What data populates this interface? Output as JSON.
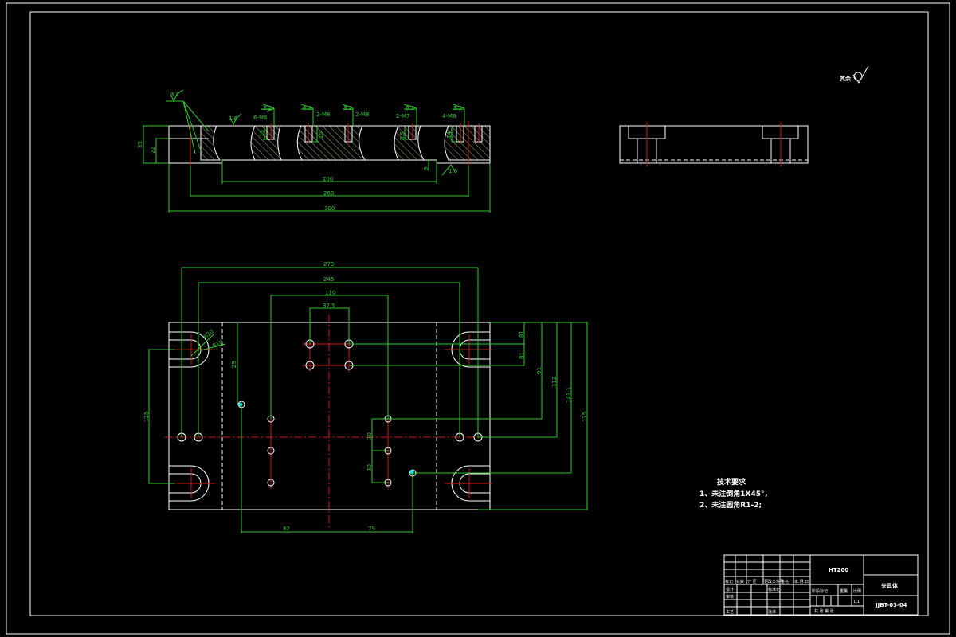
{
  "colors": {
    "background": "#000000",
    "outline": "#ffffff",
    "dimension": "#2ecc2e",
    "centerline": "#d01818",
    "highlight": "#00e5ff"
  },
  "section_view": {
    "roughness": [
      "3.2",
      "1.6",
      "3.2",
      "6.3",
      "3.2",
      "6.3",
      "3.2",
      "1.6"
    ],
    "threads": [
      "6-M6",
      "2-M8",
      "2-M8",
      "2-M7",
      "4-M8"
    ],
    "dims": {
      "width_recess": "200",
      "width_bolt": "260",
      "width_total": "300",
      "height": "35",
      "step": "22",
      "depth": "15",
      "depth2": "15",
      "depth3": "8.5",
      "depth4": "14",
      "recess_depth": "3"
    }
  },
  "plan_view": {
    "dims": {
      "d278": "278",
      "d245": "245",
      "d110": "110",
      "d37_5": "37.5",
      "d29": "29",
      "d125": "125",
      "d81a": "81",
      "d81b": "81",
      "d91": "91",
      "d112": "112",
      "d141_1": "141.1",
      "d175": "175",
      "d30a": "30",
      "d30b": "30",
      "d82": "82",
      "d79": "79",
      "r1": "R20",
      "r2": "R10"
    }
  },
  "roughness_note": {
    "label": "其余",
    "value": ""
  },
  "tech_requirements": {
    "title": "技术要求",
    "items": [
      "1、未注倒角1X45°，",
      "2、未注圆角R1-2;"
    ]
  },
  "title_block": {
    "material": "HT200",
    "part_name": "夹具体",
    "drawing_no": "JJBT-03-04",
    "headers": [
      "标记",
      "处数",
      "分 区",
      "更改文件号",
      "签名",
      "年.月.日"
    ],
    "rows": [
      "设计",
      "标准化",
      "审核",
      "工艺",
      "批准"
    ],
    "stage": "阶段标记",
    "weight": "重量",
    "scale_label": "比例",
    "scale": "1:1",
    "sheets": "共   张   第   张"
  }
}
